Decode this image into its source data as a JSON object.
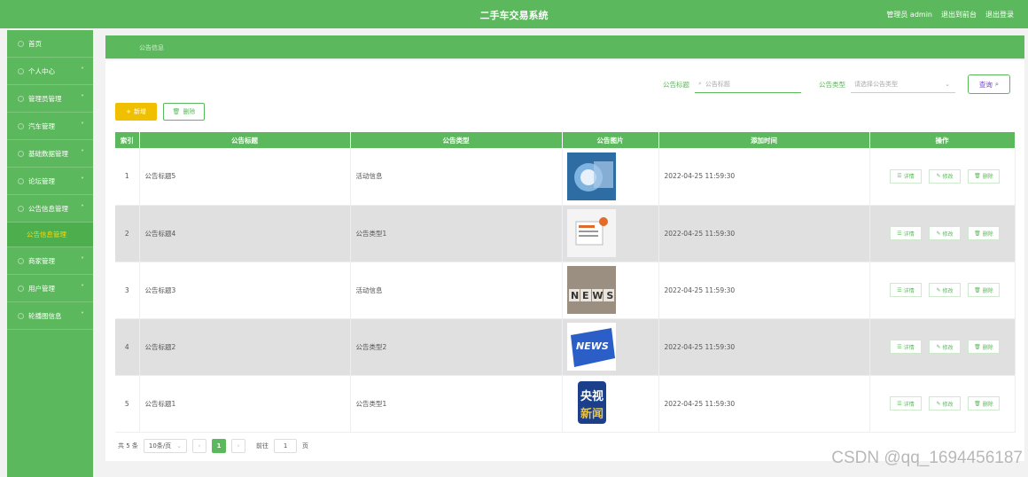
{
  "header": {
    "title": "二手车交易系统",
    "user": "管理员 admin",
    "front": "退出到前台",
    "logout": "退出登录"
  },
  "sidebar": {
    "items": [
      {
        "label": "首页",
        "has_chevron": false
      },
      {
        "label": "个人中心",
        "has_chevron": true
      },
      {
        "label": "管理员管理",
        "has_chevron": true
      },
      {
        "label": "汽车管理",
        "has_chevron": true
      },
      {
        "label": "基础数据管理",
        "has_chevron": true
      },
      {
        "label": "论坛管理",
        "has_chevron": true
      },
      {
        "label": "公告信息管理",
        "has_chevron": true,
        "expanded": true
      },
      {
        "label": "公告信息管理",
        "sub": true,
        "active": true
      },
      {
        "label": "商家管理",
        "has_chevron": true
      },
      {
        "label": "用户管理",
        "has_chevron": true
      },
      {
        "label": "轮播图信息",
        "has_chevron": true
      }
    ]
  },
  "breadcrumb": "公告信息",
  "search": {
    "title_label": "公告标题",
    "title_placeholder": "公告标题",
    "type_label": "公告类型",
    "type_placeholder": "请选择公告类型",
    "button": "查询"
  },
  "actions": {
    "add": "新增",
    "delete": "删除"
  },
  "table": {
    "columns": [
      "索引",
      "公告标题",
      "公告类型",
      "公告图片",
      "添加时间",
      "操作"
    ],
    "rows": [
      {
        "index": "1",
        "title": "公告标题5",
        "type": "活动信息",
        "image": "news-globe-image",
        "time": "2022-04-25 11:59:30"
      },
      {
        "index": "2",
        "title": "公告标题4",
        "type": "公告类型1",
        "image": "news-paper-image",
        "time": "2022-04-25 11:59:30"
      },
      {
        "index": "3",
        "title": "公告标题3",
        "type": "活动信息",
        "image": "news-blocks-image",
        "time": "2022-04-25 11:59:30"
      },
      {
        "index": "4",
        "title": "公告标题2",
        "type": "公告类型2",
        "image": "news-key-image",
        "time": "2022-04-25 11:59:30"
      },
      {
        "index": "5",
        "title": "公告标题1",
        "type": "公告类型1",
        "image": "cctv-news-logo",
        "time": "2022-04-25 11:59:30"
      }
    ],
    "op_labels": {
      "detail": "详情",
      "edit": "修改",
      "delete": "删除"
    }
  },
  "pagination": {
    "total": "共 5 条",
    "page_size": "10条/页",
    "current": "1",
    "goto_label": "前往",
    "goto_value": "1",
    "page_unit": "页"
  },
  "watermark": "CSDN @qq_1694456187",
  "colors": {
    "primary": "#5cb85c",
    "add": "#f0c000",
    "query_text": "#6f42c1"
  }
}
